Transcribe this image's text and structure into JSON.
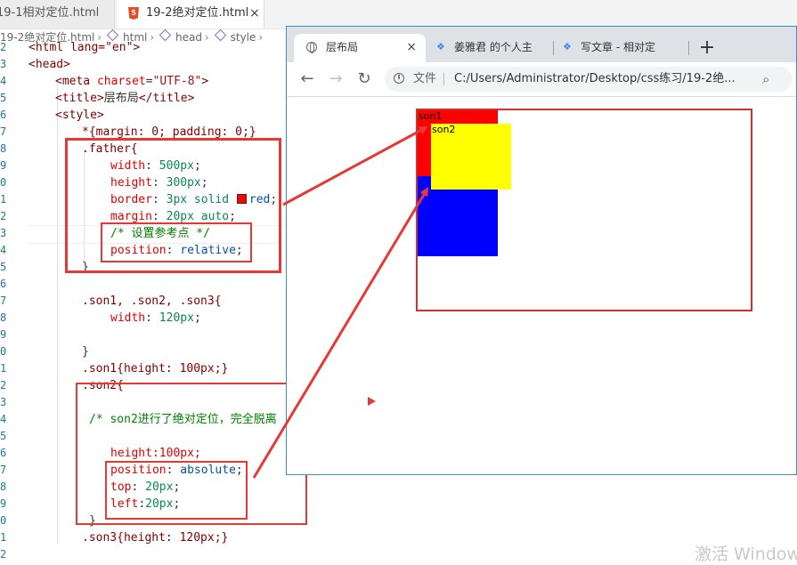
{
  "editor": {
    "tabs": [
      {
        "label": "19-1相对定位.html",
        "active": false
      },
      {
        "label": "19-2绝对定位.html",
        "active": true,
        "close": "×"
      }
    ],
    "breadcrumb": [
      "19-2绝对定位.html",
      "html",
      "head",
      "style"
    ],
    "line_numbers": [
      "2",
      "3",
      "4",
      "5",
      "6",
      "7",
      "8",
      "9",
      "0",
      "1",
      "2",
      "3",
      "4",
      "5",
      "6",
      "7",
      "8",
      "9",
      "0",
      "1",
      "2",
      "3",
      "4",
      "5",
      "6",
      "7",
      "8",
      "9",
      "0",
      "1",
      "2"
    ],
    "code": {
      "l1_a": "<html lang=\"en\">",
      "l2": "<head>",
      "l3_tag": "<meta ",
      "l3_attr": "charset",
      "l3_eq": "=",
      "l3_str": "\"UTF-8\"",
      "l3_end": ">",
      "l4_open": "<title>",
      "l4_text": "层布局",
      "l4_close": "</title>",
      "l5": "<style>",
      "l6": "*{margin: 0; padding: 0;}",
      "l7": ".father{",
      "l8_prop": "width",
      "l8_val": "500px",
      "l9_prop": "height",
      "l9_val": "300px",
      "l10_prop": "border",
      "l10_val1": "3px solid",
      "l10_val2": "red",
      "l11_prop": "margin",
      "l11_val": "20px auto",
      "l12_cmt": "/* 设置参考点 */",
      "l13_prop": "position",
      "l13_val": "relative",
      "l14": "}",
      "l16": ".son1, .son2, .son3{",
      "l17_prop": "width",
      "l17_val": "120px",
      "l19": "}",
      "l20": ".son1{height: 100px;}",
      "l21": ".son2{",
      "l23_cmt": "/* son2进行了绝对定位，完全脱离",
      "l25": "height:100px;",
      "l26_prop": "position",
      "l26_val": "absolute",
      "l27_prop": "top",
      "l27_val": "20px",
      "l28_prop": "left",
      "l28_val": "20px",
      "l29": "}",
      "l30": ".son3{height: 120px;}"
    }
  },
  "browser": {
    "tabs": [
      {
        "label": "层布局",
        "active": true,
        "close": "×"
      },
      {
        "label": "姜雅君 的个人主",
        "active": false
      },
      {
        "label": "写文章 - 相对定",
        "active": false
      }
    ],
    "new_tab": "+",
    "nav": {
      "back": "←",
      "forward": "→",
      "reload": "↻"
    },
    "scheme_label": "文件",
    "url": "C:/Users/Administrator/Desktop/css练习/19-2绝...",
    "page": {
      "son1_label": "son1",
      "son2_label": "son2"
    }
  },
  "watermark": "激活 Windows",
  "colors": {
    "annotation": "#e53935",
    "father_border": "#d32f2f",
    "son1": "#ff0000",
    "son2": "#ffff00",
    "son3": "#0000ff"
  }
}
